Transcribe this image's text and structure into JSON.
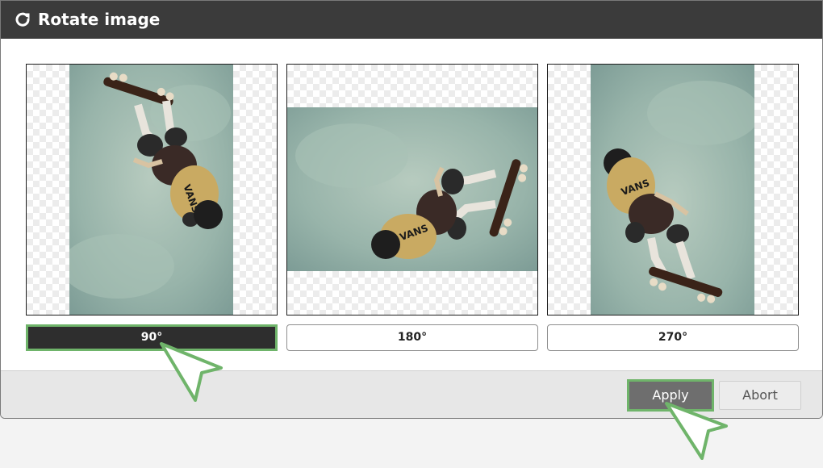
{
  "dialog": {
    "title": "Rotate image",
    "title_icon": "rotate-icon"
  },
  "rotations": [
    {
      "label": "90°",
      "degrees": 90,
      "selected": true
    },
    {
      "label": "180°",
      "degrees": 180,
      "selected": false
    },
    {
      "label": "270°",
      "degrees": 270,
      "selected": false
    }
  ],
  "footer": {
    "apply_label": "Apply",
    "abort_label": "Abort"
  },
  "colors": {
    "titlebar": "#3b3b3b",
    "selected_button": "#2e2e2e",
    "highlight_outline": "#6fb46a",
    "apply_button": "#6e6e6e"
  },
  "icons": [
    "rotate-icon",
    "pointer-cursor-icon"
  ]
}
